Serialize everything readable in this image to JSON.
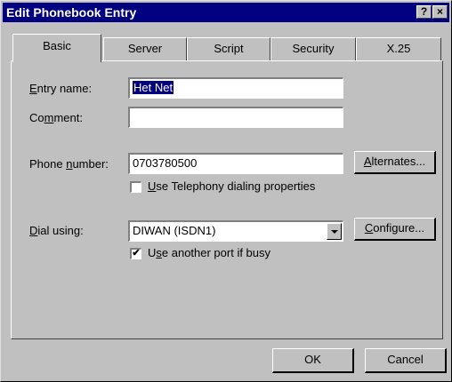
{
  "window": {
    "title": "Edit Phonebook Entry",
    "help": "?",
    "close": "×"
  },
  "tabs": [
    "Basic",
    "Server",
    "Script",
    "Security",
    "X.25"
  ],
  "form": {
    "entry_name": {
      "label_pre": "",
      "label_key": "E",
      "label_post": "ntry name:",
      "value": "Het Net"
    },
    "comment": {
      "label_pre": "Co",
      "label_key": "m",
      "label_post": "ment:",
      "value": ""
    },
    "phone": {
      "label_pre": "Phone ",
      "label_key": "n",
      "label_post": "umber:",
      "value": "0703780500"
    },
    "alternates_button": {
      "label_pre": "",
      "label_key": "A",
      "label_post": "lternates..."
    },
    "telephony_checkbox": {
      "label_pre": "",
      "label_key": "U",
      "label_post": "se Telephony dialing properties",
      "checked": false
    },
    "dial_using": {
      "label_pre": "",
      "label_key": "D",
      "label_post": "ial using:",
      "value": "DIWAN (ISDN1)"
    },
    "configure_button": {
      "label_pre": "",
      "label_key": "C",
      "label_post": "onfigure..."
    },
    "another_port_checkbox": {
      "label_pre": "U",
      "label_key": "s",
      "label_post": "e another port if busy",
      "checked": true
    }
  },
  "buttons": {
    "ok": "OK",
    "cancel": "Cancel"
  }
}
